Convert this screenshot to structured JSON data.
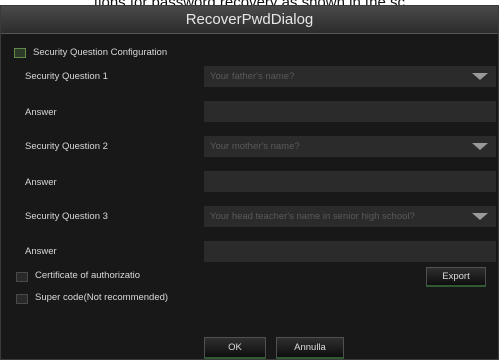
{
  "caption": "tions for password recovery as shown in the sc",
  "dialog": {
    "title": "RecoverPwdDialog",
    "config_label": "Security Question Configuration",
    "questions": [
      {
        "label": "Security Question 1",
        "placeholder": "Your father's name?",
        "answer_label": "Answer"
      },
      {
        "label": "Security Question 2",
        "placeholder": "Your mother's name?",
        "answer_label": "Answer"
      },
      {
        "label": "Security Question 3",
        "placeholder": "Your head teacher's name in senior high school?",
        "answer_label": "Answer"
      }
    ],
    "certificate_label": "Certificate of authorizatio",
    "export_label": "Export",
    "super_code_label": "Super code(Not recommended)",
    "ok_label": "OK",
    "cancel_label": "Annulla"
  },
  "colors": {
    "background": "#181818",
    "accent_green": "#5f8a48"
  }
}
